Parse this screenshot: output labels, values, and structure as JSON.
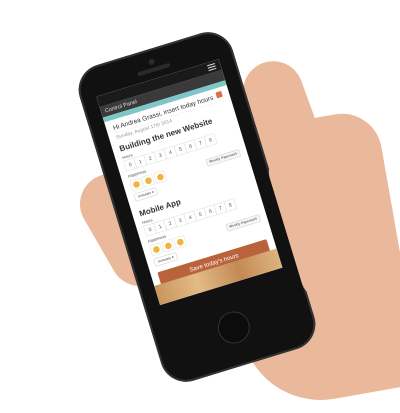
{
  "nav": {
    "title": "Control Panel"
  },
  "greeting": "Hi Andrea Grassi, insert today hours",
  "date": "Sunday, August 17th 2014",
  "projects": [
    {
      "name": "Building the new Website",
      "hours_label": "Hours",
      "hours": [
        "0",
        "1",
        "2",
        "3",
        "4",
        "5",
        "6",
        "7",
        "8"
      ],
      "happiness_label": "Happiness",
      "paperwork": "Weekly Paperwork",
      "dropdown": "Unlocate ▾"
    },
    {
      "name": "Mobile App",
      "hours_label": "Hours",
      "hours": [
        "0",
        "1",
        "2",
        "3",
        "4",
        "5",
        "6",
        "7",
        "8"
      ],
      "happiness_label": "Happiness",
      "paperwork": "Weekly Paperwork",
      "dropdown": "Unlocate ▾"
    }
  ],
  "save_label": "Save today's hours",
  "colors": {
    "accent": "#b9633d",
    "teal": "#7ec6c7"
  }
}
